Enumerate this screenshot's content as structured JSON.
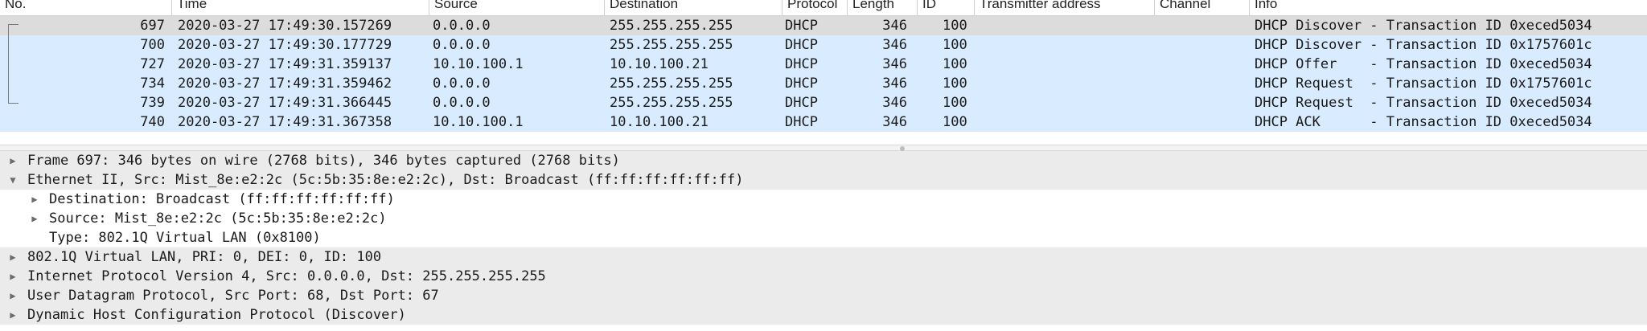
{
  "columns": [
    "No.",
    "Time",
    "Source",
    "Destination",
    "Protocol",
    "Length",
    "ID",
    "Transmitter address",
    "Channel",
    "Info"
  ],
  "packets": [
    {
      "no": "697",
      "time": "2020-03-27 17:49:30.157269",
      "src": "0.0.0.0",
      "dst": "255.255.255.255",
      "proto": "DHCP",
      "len": "346",
      "id": "100",
      "info": "DHCP Discover - Transaction ID 0xeced5034"
    },
    {
      "no": "700",
      "time": "2020-03-27 17:49:30.177729",
      "src": "0.0.0.0",
      "dst": "255.255.255.255",
      "proto": "DHCP",
      "len": "346",
      "id": "100",
      "info": "DHCP Discover - Transaction ID 0x1757601c"
    },
    {
      "no": "727",
      "time": "2020-03-27 17:49:31.359137",
      "src": "10.10.100.1",
      "dst": "10.10.100.21",
      "proto": "DHCP",
      "len": "346",
      "id": "100",
      "info": "DHCP Offer    - Transaction ID 0xeced5034"
    },
    {
      "no": "734",
      "time": "2020-03-27 17:49:31.359462",
      "src": "0.0.0.0",
      "dst": "255.255.255.255",
      "proto": "DHCP",
      "len": "346",
      "id": "100",
      "info": "DHCP Request  - Transaction ID 0x1757601c"
    },
    {
      "no": "739",
      "time": "2020-03-27 17:49:31.366445",
      "src": "0.0.0.0",
      "dst": "255.255.255.255",
      "proto": "DHCP",
      "len": "346",
      "id": "100",
      "info": "DHCP Request  - Transaction ID 0xeced5034"
    },
    {
      "no": "740",
      "time": "2020-03-27 17:49:31.367358",
      "src": "10.10.100.1",
      "dst": "10.10.100.21",
      "proto": "DHCP",
      "len": "346",
      "id": "100",
      "info": "DHCP ACK      - Transaction ID 0xeced5034"
    }
  ],
  "details": [
    {
      "text": "Frame 697: 346 bytes on wire (2768 bits), 346 bytes captured (2768 bits)",
      "expander": "collapsed"
    },
    {
      "text": "Ethernet II, Src: Mist_8e:e2:2c (5c:5b:35:8e:e2:2c), Dst: Broadcast (ff:ff:ff:ff:ff:ff)",
      "expander": "expanded"
    },
    {
      "text": "Destination: Broadcast (ff:ff:ff:ff:ff:ff)",
      "expander": "collapsed"
    },
    {
      "text": "Source: Mist_8e:e2:2c (5c:5b:35:8e:e2:2c)",
      "expander": "collapsed"
    },
    {
      "text": "Type: 802.1Q Virtual LAN (0x8100)",
      "expander": "none"
    },
    {
      "text": "802.1Q Virtual LAN, PRI: 0, DEI: 0, ID: 100",
      "expander": "collapsed"
    },
    {
      "text": "Internet Protocol Version 4, Src: 0.0.0.0, Dst: 255.255.255.255",
      "expander": "collapsed"
    },
    {
      "text": "User Datagram Protocol, Src Port: 68, Dst Port: 67",
      "expander": "collapsed"
    },
    {
      "text": "Dynamic Host Configuration Protocol (Discover)",
      "expander": "collapsed"
    }
  ],
  "icons": {
    "collapsed": "triangle-right-icon",
    "expanded": "triangle-down-icon",
    "divider_grip": "drag-grip-icon"
  },
  "colors": {
    "selected_row": "#dcdcdc",
    "related_row": "#d9ecff",
    "detail_band": "#ebebeb"
  }
}
